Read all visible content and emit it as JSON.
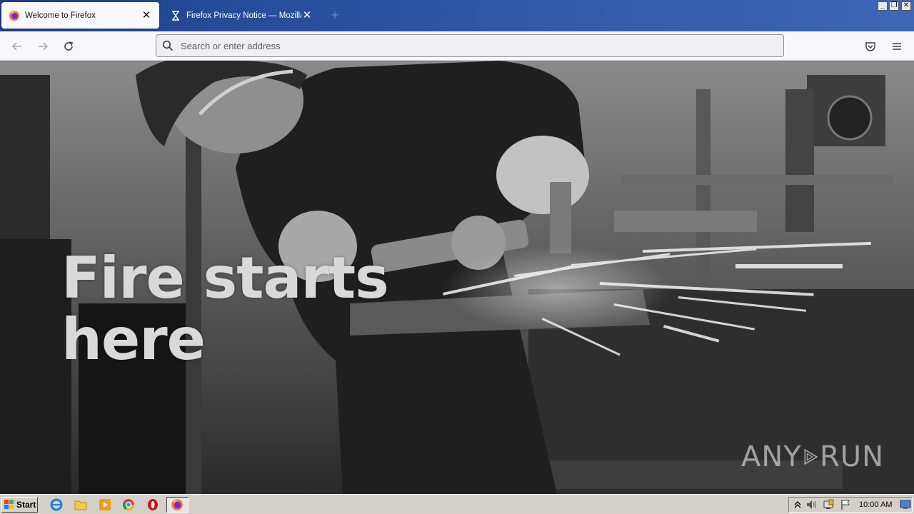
{
  "browser": {
    "tabs": [
      {
        "title": "Welcome to Firefox",
        "icon": "firefox-icon",
        "active": true
      },
      {
        "title": "Firefox Privacy Notice — Mozilla",
        "icon": "hourglass-icon",
        "active": false
      }
    ],
    "new_tab_icon": "plus-icon",
    "window_controls": [
      "minimize",
      "restore",
      "close"
    ]
  },
  "navbar": {
    "back_icon": "back-arrow-icon",
    "forward_icon": "forward-arrow-icon",
    "reload_icon": "reload-icon",
    "address_placeholder": "Search or enter address",
    "address_value": "",
    "pocket_icon": "pocket-icon",
    "menu_icon": "hamburger-menu-icon"
  },
  "content": {
    "hero_line1": "Fire starts",
    "hero_line2": "here"
  },
  "watermark": {
    "left": "ANY",
    "right": "RUN"
  },
  "taskbar": {
    "start_label": "Start",
    "icons": [
      "ie-icon",
      "explorer-folder-icon",
      "media-player-icon",
      "chrome-icon",
      "opera-icon",
      "firefox-icon"
    ],
    "tray_icons": [
      "show-hidden-icon",
      "volume-icon",
      "network-icon",
      "flag-icon"
    ],
    "clock": "10:00 AM"
  },
  "colors": {
    "titlebar": "#2c54a4",
    "toolbar": "#f9f9fb",
    "taskbar": "#d4d0c8"
  }
}
